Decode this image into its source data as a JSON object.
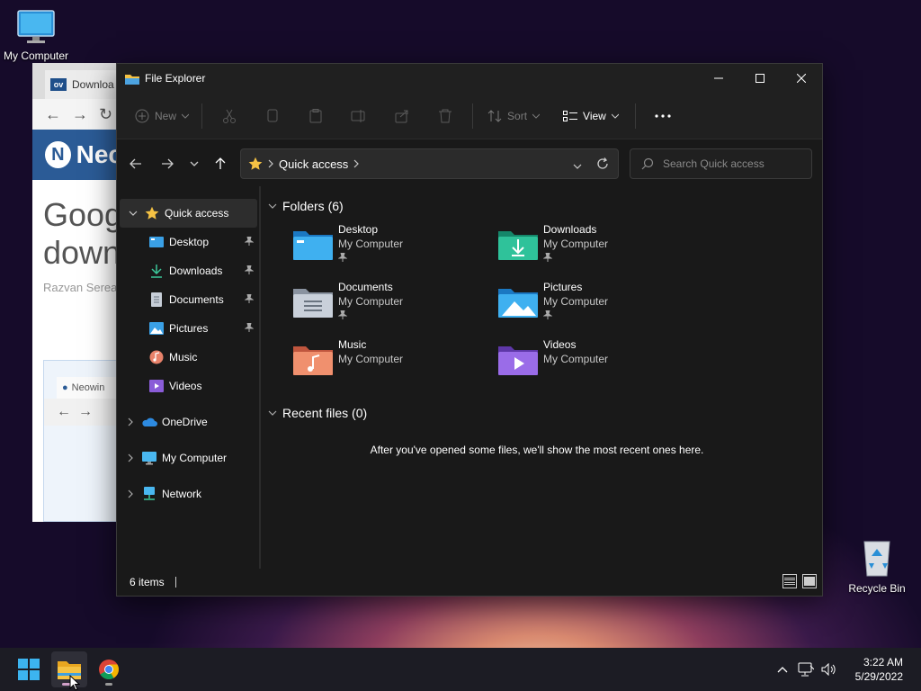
{
  "desktop": {
    "icons": [
      {
        "label": "My Computer"
      },
      {
        "label": "Recycle Bin"
      }
    ]
  },
  "browser": {
    "tab_label": "Downloa",
    "logo_text": "ov",
    "site_name": "Nec",
    "headline_1": "Goog",
    "headline_2": "down",
    "author": "Razvan Serea",
    "inner_tab": "Neowin"
  },
  "explorer": {
    "title": "File Explorer",
    "toolbar": {
      "new_label": "New",
      "sort_label": "Sort",
      "view_label": "View"
    },
    "address": {
      "crumb": "Quick access"
    },
    "search": {
      "placeholder": "Search Quick access"
    },
    "nav": {
      "quick_access": "Quick access",
      "pinned": [
        {
          "label": "Desktop",
          "pinned": true
        },
        {
          "label": "Downloads",
          "pinned": true
        },
        {
          "label": "Documents",
          "pinned": true
        },
        {
          "label": "Pictures",
          "pinned": true
        },
        {
          "label": "Music",
          "pinned": false
        },
        {
          "label": "Videos",
          "pinned": false
        }
      ],
      "onedrive": "OneDrive",
      "my_computer": "My Computer",
      "network": "Network"
    },
    "folders_header": "Folders (6)",
    "folders": [
      {
        "name": "Desktop",
        "location": "My Computer",
        "pinned": true
      },
      {
        "name": "Downloads",
        "location": "My Computer",
        "pinned": true
      },
      {
        "name": "Documents",
        "location": "My Computer",
        "pinned": true
      },
      {
        "name": "Pictures",
        "location": "My Computer",
        "pinned": true
      },
      {
        "name": "Music",
        "location": "My Computer",
        "pinned": false
      },
      {
        "name": "Videos",
        "location": "My Computer",
        "pinned": false
      }
    ],
    "recent_header": "Recent files (0)",
    "recent_empty": "After you've opened some files, we'll show the most recent ones here.",
    "status": "6 items"
  },
  "taskbar": {
    "time": "3:22 AM",
    "date": "5/29/2022"
  },
  "colors": {
    "accent": "#4cc2ff",
    "folder_yellow": "#f5c244",
    "window_bg": "#191919"
  }
}
